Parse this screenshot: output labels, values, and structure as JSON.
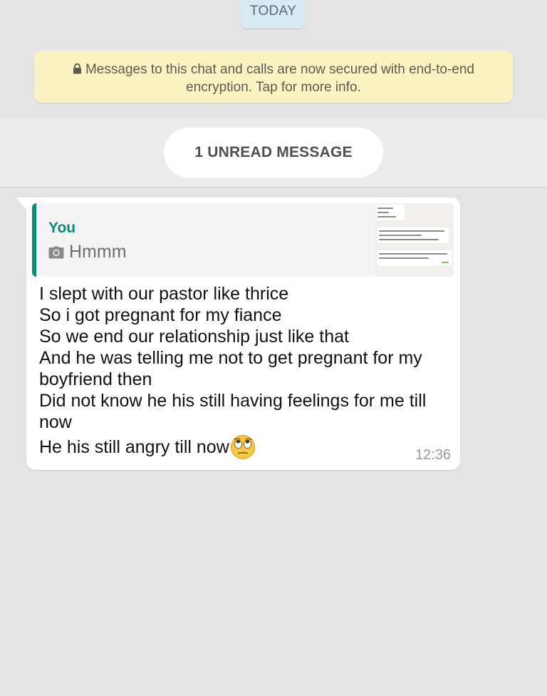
{
  "date_chip": {
    "label": "TODAY"
  },
  "encryption_notice": {
    "icon": "lock-icon",
    "text_line1": "Messages to this chat and calls are now secured with end-to-end",
    "text_line2": "encryption. Tap for more info."
  },
  "unread": {
    "label": "1 UNREAD MESSAGE"
  },
  "message": {
    "quote": {
      "author": "You",
      "icon": "camera-icon",
      "text": "Hmmm",
      "accent_color": "#0a8a78",
      "thumbnail_icon": "image-thumbnail"
    },
    "lines": [
      "I slept with our pastor like thrice",
      "So i got pregnant for my fiance",
      "So we end our relationship just like that",
      "And he was telling me not to get pregnant for my",
      "boyfriend then",
      "Did not know he his still having feelings for me till",
      "now"
    ],
    "last_line": "He his still angry till now",
    "emoji": "face-with-rolling-eyes",
    "time": "12:36"
  },
  "colors": {
    "background": "#e4e4e4",
    "notice_bg": "#fbf2c2",
    "date_chip_bg": "#d8eaf3",
    "bubble_bg": "#ffffff"
  }
}
